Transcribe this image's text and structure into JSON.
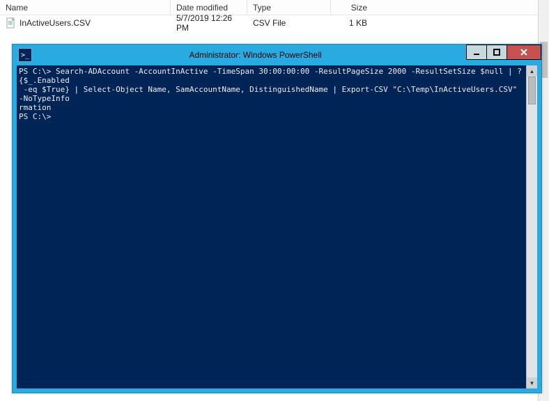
{
  "explorer": {
    "columns": {
      "name": "Name",
      "date": "Date modified",
      "type": "Type",
      "size": "Size"
    },
    "file": {
      "name": "InActiveUsers.CSV",
      "date": "5/7/2019 12:26 PM",
      "type": "CSV File",
      "size": "1 KB"
    }
  },
  "powershell": {
    "title": "Administrator: Windows PowerShell",
    "icon_glyph": ">_",
    "controls": {
      "min": "—",
      "max": "☐",
      "close": "✕"
    },
    "content": "PS C:\\> Search-ADAccount -AccountInActive -TimeSpan 30:00:00:00 -ResultPageSize 2000 -ResultSetSize $null | ?{$_.Enabled\n -eq $True} | Select-Object Name, SamAccountName, DistinguishedName | Export-CSV \"C:\\Temp\\InActiveUsers.CSV\" -NoTypeInfo\nrmation\nPS C:\\>",
    "scroll": {
      "up": "▲",
      "down": "▼"
    }
  }
}
